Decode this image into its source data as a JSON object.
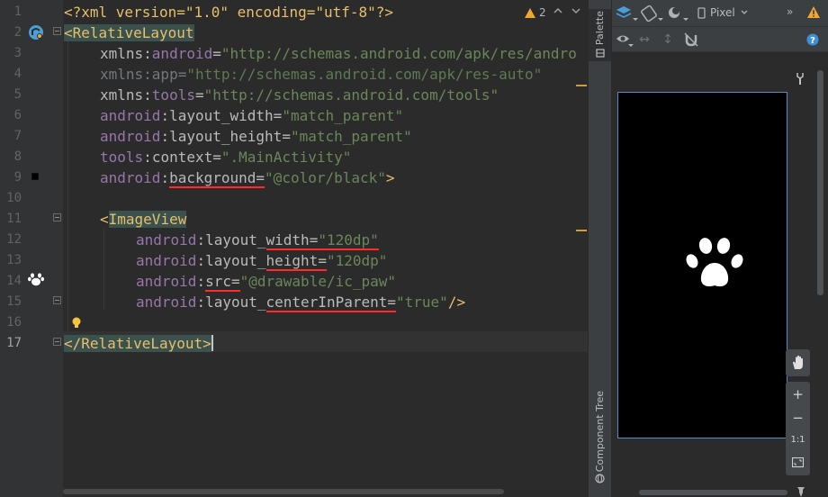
{
  "editor": {
    "line_numbers": [
      "1",
      "2",
      "3",
      "4",
      "5",
      "6",
      "7",
      "8",
      "9",
      "10",
      "11",
      "12",
      "13",
      "14",
      "15",
      "16",
      "17"
    ],
    "lines": {
      "l1": {
        "decl": "<?xml version=\"1.0\" encoding=\"utf-8\"?>"
      },
      "l2": {
        "open": "<",
        "tag": "RelativeLayout"
      },
      "l3": {
        "ns": "xmlns:",
        "name": "android",
        "eq": "=",
        "val": "\"http://schemas.android.com/apk/res/andro"
      },
      "l4": {
        "ns": "xmlns:",
        "name": "app",
        "eq": "=",
        "val": "\"http://schemas.android.com/apk/res-auto\""
      },
      "l5": {
        "ns": "xmlns:",
        "name": "tools",
        "eq": "=",
        "val": "\"http://schemas.android.com/tools\""
      },
      "l6": {
        "ns": "android",
        "colon": ":",
        "name": "layout_width",
        "eq": "=",
        "val": "\"match_parent\""
      },
      "l7": {
        "ns": "android",
        "colon": ":",
        "name": "layout_height",
        "eq": "=",
        "val": "\"match_parent\""
      },
      "l8": {
        "ns": "tools",
        "colon": ":",
        "name": "context",
        "eq": "=",
        "val": "\".MainActivity\""
      },
      "l9": {
        "ns": "android",
        "colon": ":",
        "name": "background",
        "eq": "=",
        "val": "\"@color/black\"",
        "close": ">"
      },
      "l11": {
        "open": "<",
        "tag": "ImageView"
      },
      "l12": {
        "ns": "android",
        "colon": ":",
        "pre": "layout_",
        "name": "width",
        "eq": "=",
        "val": "\"120dp\""
      },
      "l13": {
        "ns": "android",
        "colon": ":",
        "pre": "layout_",
        "name": "height",
        "eq": "=",
        "val": "\"120dp\""
      },
      "l14": {
        "ns": "android",
        "colon": ":",
        "name": "src",
        "eq": "=",
        "val": "\"@drawable/ic_paw\""
      },
      "l15": {
        "ns": "android",
        "colon": ":",
        "pre": "layout_",
        "name": "centerInParent",
        "eq": "=",
        "val": "\"true\"",
        "close": "/>"
      },
      "l17": {
        "open": "</",
        "tag": "RelativeLayout",
        "close": ">"
      }
    },
    "warnings_count": "2"
  },
  "side_tabs": {
    "palette": "Palette",
    "component_tree": "Component Tree"
  },
  "design": {
    "device": "Pixel",
    "zoom_in": "+",
    "zoom_out": "−",
    "zoom_actual": "1:1",
    "phone_background": "#000000"
  },
  "colors": {
    "accent": "#4f8cd0",
    "error_underline": "#ff2b2b",
    "warning": "#f0a732"
  }
}
